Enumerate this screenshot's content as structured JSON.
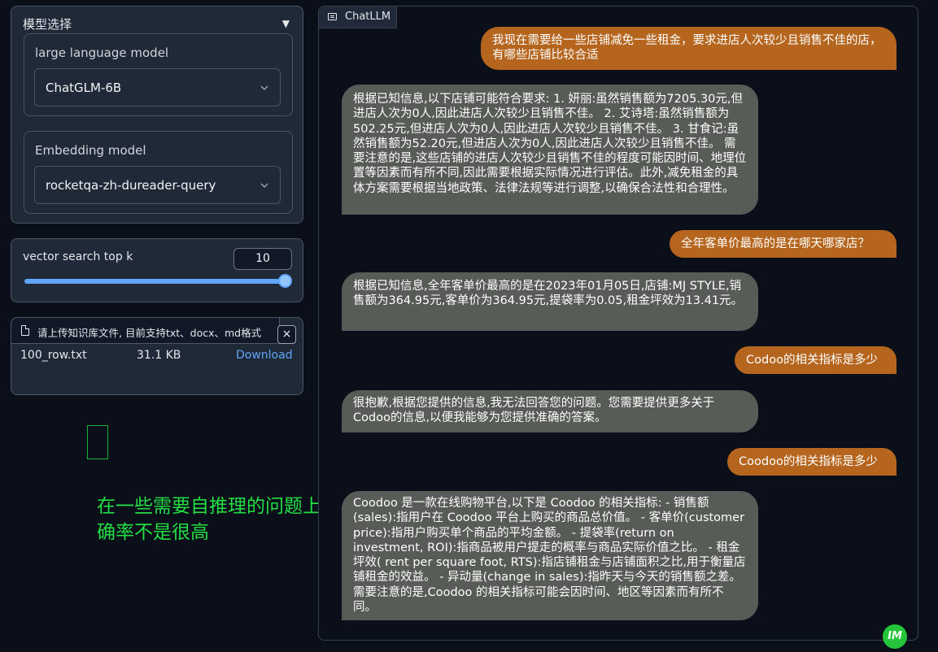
{
  "sidebar": {
    "model_select": {
      "title": "模型选择",
      "arrow": "▼",
      "llm": {
        "label": "large language model",
        "value": "ChatGLM-6B"
      },
      "embedding": {
        "label": "Embedding model",
        "value": "rocketqa-zh-dureader-query"
      }
    },
    "topk": {
      "label": "vector search top k",
      "value": "10",
      "slider_fraction": 1.0
    },
    "upload": {
      "hint": "请上传知识库文件, 目前支持txt、docx、md格式",
      "close": "×",
      "file": {
        "name": "100_row.txt",
        "size": "31.1 KB",
        "download": "Download"
      }
    }
  },
  "annotation": {
    "text": "在一些需要自推理的问题上正确率不是很高",
    "color": "#22dd44"
  },
  "chat": {
    "tab_label": "ChatLLM",
    "messages": [
      {
        "role": "user",
        "text": "我现在需要给一些店铺减免一些租金，要求进店人次较少且销售不佳的店，有哪些店铺比较合适"
      },
      {
        "role": "bot",
        "text": "根据已知信息,以下店铺可能符合要求: 1. 妍丽:虽然销售额为7205.30元,但进店人次为0人,因此进店人次较少且销售不佳。 2. 艾诗塔:虽然销售额为502.25元,但进店人次为0人,因此进店人次较少且销售不佳。 3. 甘食记:虽然销售额为52.20元,但进店人次为0人,因此进店人次较少且销售不佳。 需要注意的是,这些店铺的进店人次较少且销售不佳的程度可能因时间、地理位置等因素而有所不同,因此需要根据实际情况进行评估。此外,减免租金的具体方案需要根据当地政策、法律法规等进行调整,以确保合法性和合理性。"
      },
      {
        "role": "user",
        "text": "全年客单价最高的是在哪天哪家店？"
      },
      {
        "role": "bot",
        "text": "根据已知信息,全年客单价最高的是在2023年01月05日,店铺:MJ STYLE,销售额为364.95元,客单价为364.95元,提袋率为0.05,租金坪效为13.41元。"
      },
      {
        "role": "user",
        "text": "Codoo的相关指标是多少"
      },
      {
        "role": "bot",
        "text": "很抱歉,根据您提供的信息,我无法回答您的问题。您需要提供更多关于Codoo的信息,以便我能够为您提供准确的答案。"
      },
      {
        "role": "user",
        "text": "Coodoo的相关指标是多少"
      },
      {
        "role": "bot",
        "text": "Coodoo 是一款在线购物平台,以下是 Coodoo 的相关指标: - 销售额(sales):指用户在 Coodoo 平台上购买的商品总价值。 - 客单价(customer price):指用户购买单个商品的平均金额。 - 提袋率(return on investment, ROI):指商品被用户提走的概率与商品实际价值之比。 - 租金坪效( rent per square foot, RTS):指店铺租金与店铺面积之比,用于衡量店铺租金的效益。 - 异动量(change in sales):指昨天与今天的销售额之差。 需要注意的是,Coodoo 的相关指标可能会因时间、地区等因素而有所不同。"
      }
    ]
  },
  "watermark": {
    "text": "IM",
    "color": "#25c43a"
  }
}
